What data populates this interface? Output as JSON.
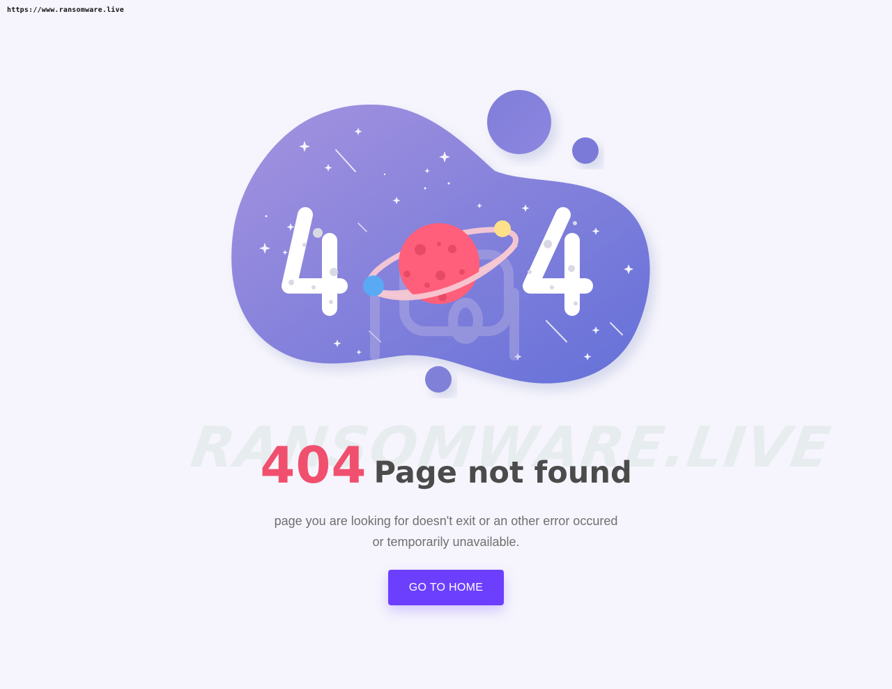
{
  "address_bar": {
    "url": "https://www.ransomware.live"
  },
  "illustration": {
    "left_digit": "4",
    "right_digit": "4",
    "watermark_text": "RANSOMWARE.LIVE"
  },
  "error": {
    "code": "404",
    "title": "Page not found",
    "message_line1": "page you are looking for doesn't exit or an other error occured",
    "message_line2": "or temporarily unavailable."
  },
  "actions": {
    "home_label": "GO TO HOME"
  },
  "colors": {
    "background": "#f6f5fd",
    "code": "#f0506e",
    "title": "#4b4b4b",
    "button": "#6c3ffe",
    "blob_start": "#a593df",
    "blob_end": "#6470d8",
    "planet": "#ff5f7a",
    "moon_blue": "#5aa9f5",
    "moon_yellow": "#ffe08a"
  },
  "icons": {
    "planet": "planet-icon",
    "stars": "star-icon",
    "bubbles": "bubble-icon"
  }
}
